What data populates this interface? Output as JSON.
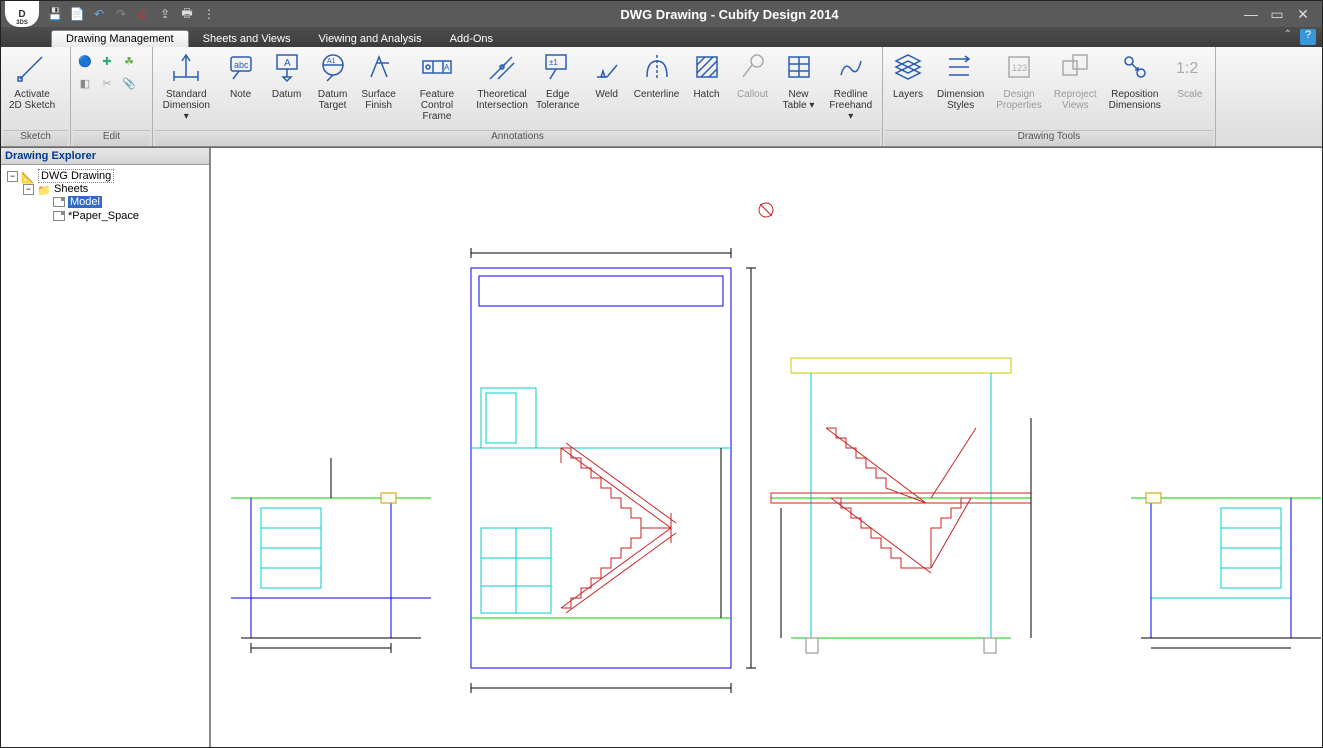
{
  "window": {
    "title": "DWG Drawing - Cubify Design 2014",
    "logo_top": "D"
  },
  "qat": [
    "save",
    "new",
    "undo",
    "redo",
    "pdf",
    "export",
    "print",
    "options"
  ],
  "tabs": [
    {
      "label": "Drawing Management",
      "active": true
    },
    {
      "label": "Sheets and Views",
      "active": false
    },
    {
      "label": "Viewing and Analysis",
      "active": false
    },
    {
      "label": "Add-Ons",
      "active": false
    }
  ],
  "ribbon": {
    "panels": [
      {
        "label": "Sketch",
        "large": [
          {
            "label": "Activate\n2D Sketch",
            "icon": "sketch",
            "dim": false,
            "dd": false
          }
        ],
        "small": []
      },
      {
        "label": "Edit",
        "large": [],
        "small": [
          "sphere",
          "cross",
          "leaf",
          "cube",
          "scissors",
          "clip",
          "dash",
          "dash",
          "dash"
        ]
      },
      {
        "label": "Annotations",
        "large": [
          {
            "label": "Standard\nDimension ▾",
            "icon": "dimension",
            "dd": true
          },
          {
            "label": "Note",
            "icon": "note"
          },
          {
            "label": "Datum",
            "icon": "datum"
          },
          {
            "label": "Datum\nTarget",
            "icon": "datum-target"
          },
          {
            "label": "Surface\nFinish",
            "icon": "surface-finish"
          },
          {
            "label": "Feature\nControl Frame",
            "icon": "fcf"
          },
          {
            "label": "Theoretical\nIntersection",
            "icon": "theoretical"
          },
          {
            "label": "Edge\nTolerance",
            "icon": "edge-tol"
          },
          {
            "label": "Weld",
            "icon": "weld"
          },
          {
            "label": "Centerline",
            "icon": "centerline"
          },
          {
            "label": "Hatch",
            "icon": "hatch"
          },
          {
            "label": "Callout",
            "icon": "callout",
            "dim": true
          },
          {
            "label": "New\nTable ▾",
            "icon": "table",
            "dd": true
          },
          {
            "label": "Redline\nFreehand ▾",
            "icon": "redline",
            "dd": true
          }
        ]
      },
      {
        "label": "Drawing Tools",
        "large": [
          {
            "label": "Layers",
            "icon": "layers"
          },
          {
            "label": "Dimension\nStyles",
            "icon": "dim-styles"
          },
          {
            "label": "Design\nProperties",
            "icon": "design-props",
            "dim": true
          },
          {
            "label": "Reproject\nViews",
            "icon": "reproject",
            "dim": true
          },
          {
            "label": "Reposition\nDimensions",
            "icon": "reposition"
          },
          {
            "label": "Scale",
            "icon": "scale",
            "dim": true
          }
        ]
      }
    ]
  },
  "explorer": {
    "title": "Drawing Explorer",
    "tree": {
      "root": {
        "label": "DWG Drawing",
        "expanded": true
      },
      "sheets": {
        "label": "Sheets",
        "expanded": true
      },
      "items": [
        {
          "label": "Model",
          "selected": true
        },
        {
          "label": "*Paper_Space",
          "selected": false
        }
      ]
    }
  }
}
